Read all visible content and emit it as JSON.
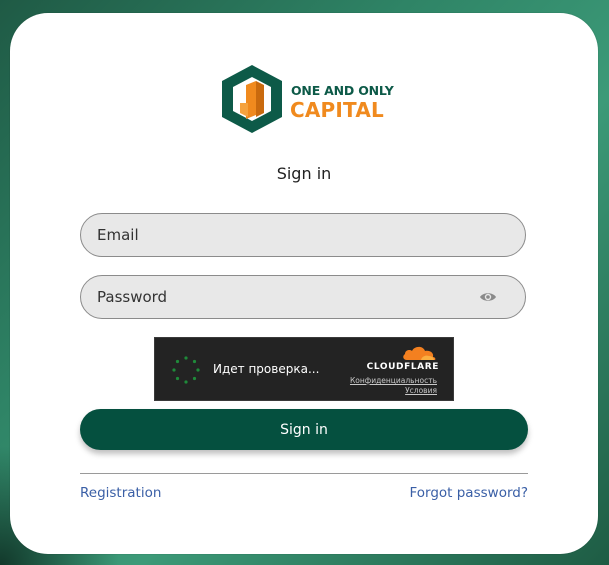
{
  "brand": {
    "line1": "ONE AND ONLY",
    "line2": "CAPITAL",
    "colors": {
      "teal": "#0d5a48",
      "orange": "#f08a1e"
    }
  },
  "form": {
    "title": "Sign in",
    "email_placeholder": "Email",
    "password_placeholder": "Password",
    "submit_label": "Sign in",
    "accent_color": "#05503f"
  },
  "captcha": {
    "status_text": "Идет проверка...",
    "provider": "CLOUDFLARE",
    "privacy_link": "Конфиденциальность",
    "terms_link": "Условия"
  },
  "links": {
    "registration": "Registration",
    "forgot_password": "Forgot password?"
  },
  "icons": {
    "logo": "hexagon-logo-icon",
    "password_toggle": "eye-icon",
    "spinner": "loading-spinner-icon",
    "cloudflare": "cloudflare-cloud-icon"
  }
}
